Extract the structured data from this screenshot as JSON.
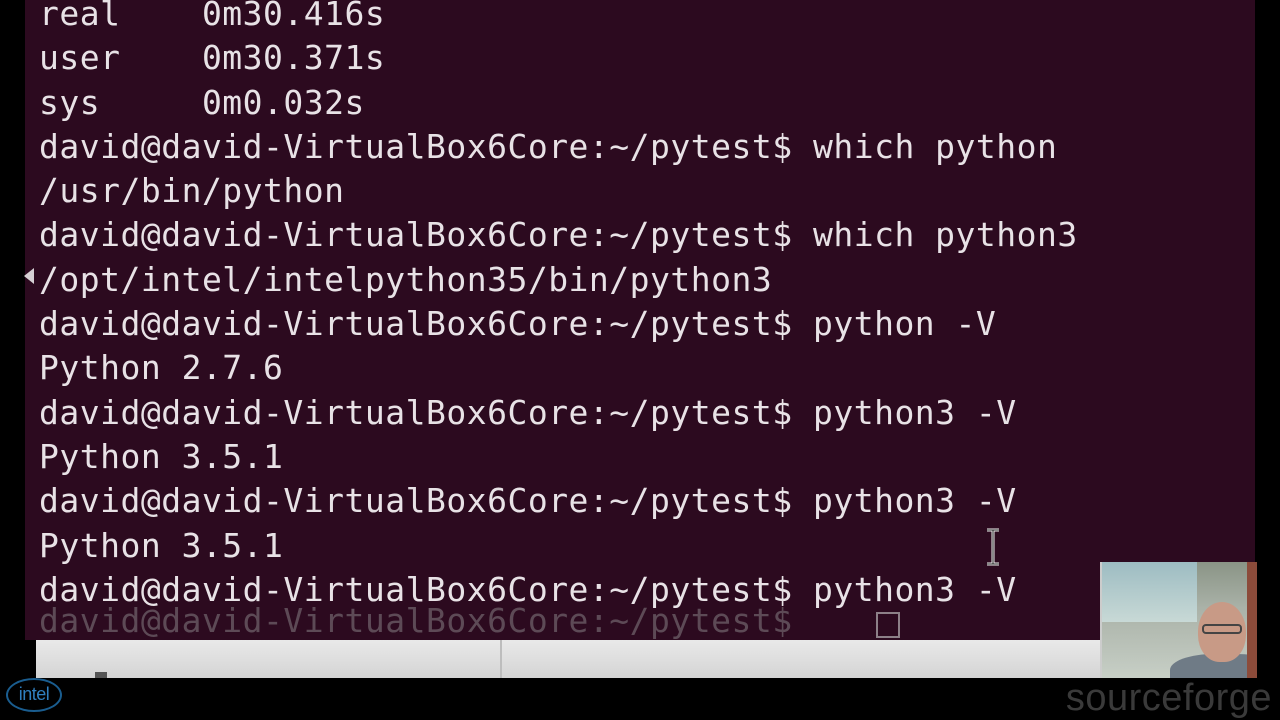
{
  "terminal": {
    "lines": [
      "real    0m30.416s",
      "user    0m30.371s",
      "sys     0m0.032s",
      "david@david-VirtualBox6Core:~/pytest$ which python",
      "/usr/bin/python",
      "david@david-VirtualBox6Core:~/pytest$ which python3",
      "/opt/intel/intelpython35/bin/python3",
      "david@david-VirtualBox6Core:~/pytest$ python -V",
      "Python 2.7.6",
      "david@david-VirtualBox6Core:~/pytest$ python3 -V",
      "Python 3.5.1",
      "david@david-VirtualBox6Core:~/pytest$ python3 -V",
      "Python 3.5.1",
      "david@david-VirtualBox6Core:~/pytest$ python3 -V"
    ],
    "ghost_prompt": "david@david-VirtualBox6Core:~/pytest$",
    "background_color": "#2c0a1f",
    "text_color": "#e8e2e6"
  },
  "overlays": {
    "intel_logo": "intel",
    "sourceforge_logo": "sourceforge"
  }
}
